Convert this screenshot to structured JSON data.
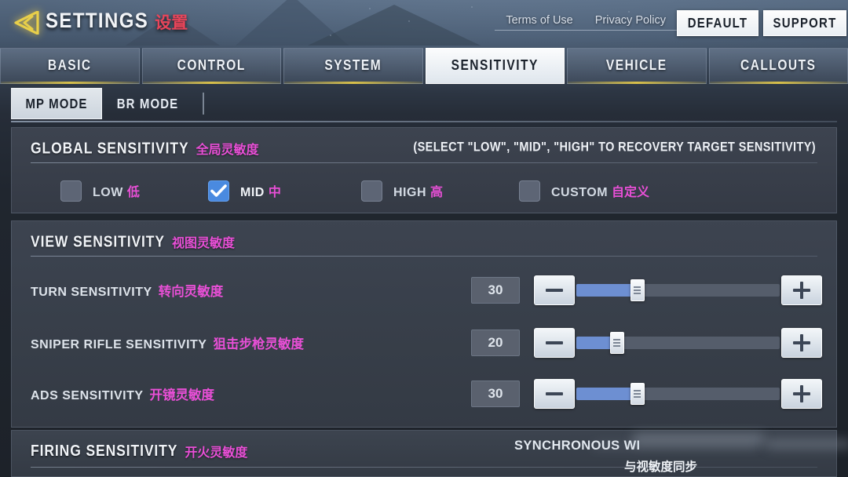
{
  "header": {
    "back_icon": "back-arrow-icon",
    "title_en": "SETTINGS",
    "title_cn": "设置",
    "terms_label": "Terms of Use",
    "privacy_label": "Privacy Policy",
    "default_label": "DEFAULT",
    "support_label": "SUPPORT",
    "accent_gold": "#e8cf4a",
    "title_cn_color": "#e8455a"
  },
  "tabs": [
    {
      "label": "BASIC",
      "active": false
    },
    {
      "label": "CONTROL",
      "active": false
    },
    {
      "label": "SYSTEM",
      "active": false
    },
    {
      "label": "SENSITIVITY",
      "active": true
    },
    {
      "label": "VEHICLE",
      "active": false
    },
    {
      "label": "CALLOUTS",
      "active": false
    }
  ],
  "subtabs": [
    {
      "label": "MP MODE",
      "active": true
    },
    {
      "label": "BR MODE",
      "active": false
    }
  ],
  "global_sensitivity": {
    "title_en": "GLOBAL SENSITIVITY",
    "title_cn": "全局灵敏度",
    "hint": "(SELECT \"LOW\", \"MID\", \"HIGH\" TO RECOVERY TARGET SENSITIVITY)",
    "options": [
      {
        "en": "LOW",
        "cn": "低",
        "checked": false
      },
      {
        "en": "MID",
        "cn": "中",
        "checked": true
      },
      {
        "en": "HIGH",
        "cn": "高",
        "checked": false
      },
      {
        "en": "CUSTOM",
        "cn": "自定义",
        "checked": false
      }
    ]
  },
  "view_sensitivity": {
    "title_en": "VIEW SENSITIVITY",
    "title_cn": "视图灵敏度",
    "rows": [
      {
        "en": "TURN SENSITIVITY",
        "cn": "转向灵敏度",
        "value": "30",
        "percent": 30,
        "minus": "−",
        "plus": "+"
      },
      {
        "en": "SNIPER RIFLE SENSITIVITY",
        "cn": "狙击步枪灵敏度",
        "value": "20",
        "percent": 20,
        "minus": "−",
        "plus": "+"
      },
      {
        "en": "ADS SENSITIVITY",
        "cn": "开镜灵敏度",
        "value": "30",
        "percent": 30,
        "minus": "−",
        "plus": "+"
      }
    ]
  },
  "firing_sensitivity": {
    "title_en": "FIRING SENSITIVITY",
    "title_cn": "开火灵敏度",
    "sync_en": "SYNCHRONOUS WI",
    "sync_cn": "与视敏度同步"
  },
  "colors": {
    "magenta_cn": "#e84fd6",
    "slider_fill": "#6d8fd2",
    "checkbox_on": "#4a8ae0",
    "panel_bg": "#3f4652"
  }
}
